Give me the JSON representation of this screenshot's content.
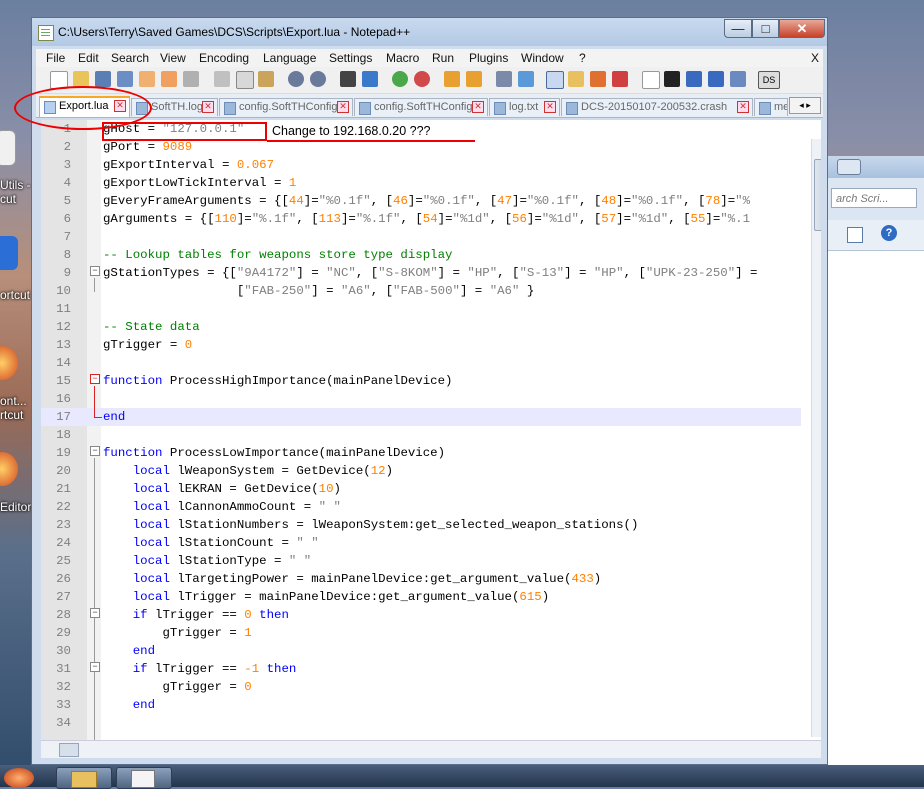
{
  "window": {
    "title": "C:\\Users\\Terry\\Saved Games\\DCS\\Scripts\\Export.lua - Notepad++",
    "min_glyph": "—",
    "max_glyph": "□",
    "close_glyph": "✕"
  },
  "desktop": {
    "icons": [
      {
        "label": "Utils -\ncut"
      },
      {
        "label": "ortcut"
      },
      {
        "label": "ont...\nrtcut"
      },
      {
        "label": "Editor"
      }
    ]
  },
  "bg_window": {
    "search_placeholder": "arch Scri..."
  },
  "menu": [
    "File",
    "Edit",
    "Search",
    "View",
    "Encoding",
    "Language",
    "Settings",
    "Macro",
    "Run",
    "Plugins",
    "Window",
    "?"
  ],
  "menu_close": "X",
  "tabs": [
    {
      "label": "Export.lua",
      "active": true
    },
    {
      "label": "SoftTH.log",
      "active": false
    },
    {
      "label": "config.SoftTHConfig",
      "active": false
    },
    {
      "label": "config.SoftTHConfig",
      "active": false
    },
    {
      "label": "log.txt",
      "active": false
    },
    {
      "label": "DCS-20150107-200532.crash",
      "active": false
    },
    {
      "label": "me.lo",
      "active": false
    }
  ],
  "tab_close": "✕",
  "annotation": "Change to 192.168.0.20 ???",
  "colors": {
    "keyword": "#0000ff",
    "number": "#ff8000",
    "string": "#808080",
    "comment": "#008000",
    "annotation": "#e00000"
  },
  "lines": [
    {
      "n": "1",
      "segs": [
        [
          "",
          "gHost = "
        ],
        [
          "s",
          "\"127.0.0.1\""
        ]
      ]
    },
    {
      "n": "2",
      "segs": [
        [
          "",
          "gPort = "
        ],
        [
          "n",
          "9089"
        ]
      ]
    },
    {
      "n": "3",
      "segs": [
        [
          "",
          "gExportInterval = "
        ],
        [
          "n",
          "0.067"
        ]
      ]
    },
    {
      "n": "4",
      "segs": [
        [
          "",
          "gExportLowTickInterval = "
        ],
        [
          "n",
          "1"
        ]
      ]
    },
    {
      "n": "5",
      "segs": [
        [
          "",
          "gEveryFrameArguments = {["
        ],
        [
          "n",
          "44"
        ],
        [
          "",
          "]="
        ],
        [
          "s",
          "\"%0.1f\""
        ],
        [
          "",
          ", ["
        ],
        [
          "n",
          "46"
        ],
        [
          "",
          "]="
        ],
        [
          "s",
          "\"%0.1f\""
        ],
        [
          "",
          ", ["
        ],
        [
          "n",
          "47"
        ],
        [
          "",
          "]="
        ],
        [
          "s",
          "\"%0.1f\""
        ],
        [
          "",
          ", ["
        ],
        [
          "n",
          "48"
        ],
        [
          "",
          "]="
        ],
        [
          "s",
          "\"%0.1f\""
        ],
        [
          "",
          ", ["
        ],
        [
          "n",
          "78"
        ],
        [
          "",
          "]="
        ],
        [
          "s",
          "\"%"
        ]
      ]
    },
    {
      "n": "6",
      "segs": [
        [
          "",
          "gArguments = {["
        ],
        [
          "n",
          "110"
        ],
        [
          "",
          "]="
        ],
        [
          "s",
          "\"%.1f\""
        ],
        [
          "",
          ", ["
        ],
        [
          "n",
          "113"
        ],
        [
          "",
          "]="
        ],
        [
          "s",
          "\"%.1f\""
        ],
        [
          "",
          ", ["
        ],
        [
          "n",
          "54"
        ],
        [
          "",
          "]="
        ],
        [
          "s",
          "\"%1d\""
        ],
        [
          "",
          ", ["
        ],
        [
          "n",
          "56"
        ],
        [
          "",
          "]="
        ],
        [
          "s",
          "\"%1d\""
        ],
        [
          "",
          ", ["
        ],
        [
          "n",
          "57"
        ],
        [
          "",
          "]="
        ],
        [
          "s",
          "\"%1d\""
        ],
        [
          "",
          ", ["
        ],
        [
          "n",
          "55"
        ],
        [
          "",
          "]="
        ],
        [
          "s",
          "\"%.1"
        ]
      ]
    },
    {
      "n": "7",
      "segs": []
    },
    {
      "n": "8",
      "segs": [
        [
          "c",
          "-- Lookup tables for weapons store type display"
        ]
      ]
    },
    {
      "n": "9",
      "segs": [
        [
          "",
          "gStationTypes = {["
        ],
        [
          "s",
          "\"9A4172\""
        ],
        [
          "",
          "] = "
        ],
        [
          "s",
          "\"NC\""
        ],
        [
          "",
          ", ["
        ],
        [
          "s",
          "\"S-8KOM\""
        ],
        [
          "",
          "] = "
        ],
        [
          "s",
          "\"HP\""
        ],
        [
          "",
          ", ["
        ],
        [
          "s",
          "\"S-13\""
        ],
        [
          "",
          "] = "
        ],
        [
          "s",
          "\"HP\""
        ],
        [
          "",
          ", ["
        ],
        [
          "s",
          "\"UPK-23-250\""
        ],
        [
          "",
          "] ="
        ]
      ]
    },
    {
      "n": "10",
      "segs": [
        [
          "",
          "                  ["
        ],
        [
          "s",
          "\"FAB-250\""
        ],
        [
          "",
          "] = "
        ],
        [
          "s",
          "\"A6\""
        ],
        [
          "",
          ", ["
        ],
        [
          "s",
          "\"FAB-500\""
        ],
        [
          "",
          "] = "
        ],
        [
          "s",
          "\"A6\""
        ],
        [
          "",
          " }"
        ]
      ]
    },
    {
      "n": "11",
      "segs": []
    },
    {
      "n": "12",
      "segs": [
        [
          "c",
          "-- State data"
        ]
      ]
    },
    {
      "n": "13",
      "segs": [
        [
          "",
          "gTrigger = "
        ],
        [
          "n",
          "0"
        ]
      ]
    },
    {
      "n": "14",
      "segs": []
    },
    {
      "n": "15",
      "segs": [
        [
          "k",
          "function"
        ],
        [
          "",
          " ProcessHighImportance(mainPanelDevice)"
        ]
      ]
    },
    {
      "n": "16",
      "segs": []
    },
    {
      "n": "17",
      "segs": [
        [
          "k",
          "end"
        ]
      ]
    },
    {
      "n": "18",
      "segs": []
    },
    {
      "n": "19",
      "segs": [
        [
          "k",
          "function"
        ],
        [
          "",
          " ProcessLowImportance(mainPanelDevice)"
        ]
      ]
    },
    {
      "n": "20",
      "segs": [
        [
          "",
          "    "
        ],
        [
          "k",
          "local"
        ],
        [
          "",
          " lWeaponSystem = GetDevice("
        ],
        [
          "n",
          "12"
        ],
        [
          "",
          ")"
        ]
      ]
    },
    {
      "n": "21",
      "segs": [
        [
          "",
          "    "
        ],
        [
          "k",
          "local"
        ],
        [
          "",
          " lEKRAN = GetDevice("
        ],
        [
          "n",
          "10"
        ],
        [
          "",
          ")"
        ]
      ]
    },
    {
      "n": "22",
      "segs": [
        [
          "",
          "    "
        ],
        [
          "k",
          "local"
        ],
        [
          "",
          " lCannonAmmoCount = "
        ],
        [
          "s",
          "\" \""
        ]
      ]
    },
    {
      "n": "23",
      "segs": [
        [
          "",
          "    "
        ],
        [
          "k",
          "local"
        ],
        [
          "",
          " lStationNumbers = lWeaponSystem:get_selected_weapon_stations()"
        ]
      ]
    },
    {
      "n": "24",
      "segs": [
        [
          "",
          "    "
        ],
        [
          "k",
          "local"
        ],
        [
          "",
          " lStationCount = "
        ],
        [
          "s",
          "\" \""
        ]
      ]
    },
    {
      "n": "25",
      "segs": [
        [
          "",
          "    "
        ],
        [
          "k",
          "local"
        ],
        [
          "",
          " lStationType = "
        ],
        [
          "s",
          "\" \""
        ]
      ]
    },
    {
      "n": "26",
      "segs": [
        [
          "",
          "    "
        ],
        [
          "k",
          "local"
        ],
        [
          "",
          " lTargetingPower = mainPanelDevice:get_argument_value("
        ],
        [
          "n",
          "433"
        ],
        [
          "",
          ")"
        ]
      ]
    },
    {
      "n": "27",
      "segs": [
        [
          "",
          "    "
        ],
        [
          "k",
          "local"
        ],
        [
          "",
          " lTrigger = mainPanelDevice:get_argument_value("
        ],
        [
          "n",
          "615"
        ],
        [
          "",
          ")"
        ]
      ]
    },
    {
      "n": "28",
      "segs": [
        [
          "",
          "    "
        ],
        [
          "k",
          "if"
        ],
        [
          "",
          " lTrigger == "
        ],
        [
          "n",
          "0"
        ],
        [
          "",
          " "
        ],
        [
          "k",
          "then"
        ]
      ]
    },
    {
      "n": "29",
      "segs": [
        [
          "",
          "        gTrigger = "
        ],
        [
          "n",
          "1"
        ]
      ]
    },
    {
      "n": "30",
      "segs": [
        [
          "",
          "    "
        ],
        [
          "k",
          "end"
        ]
      ]
    },
    {
      "n": "31",
      "segs": [
        [
          "",
          "    "
        ],
        [
          "k",
          "if"
        ],
        [
          "",
          " lTrigger == "
        ],
        [
          "n",
          "-1"
        ],
        [
          "",
          " "
        ],
        [
          "k",
          "then"
        ]
      ]
    },
    {
      "n": "32",
      "segs": [
        [
          "",
          "        gTrigger = "
        ],
        [
          "n",
          "0"
        ]
      ]
    },
    {
      "n": "33",
      "segs": [
        [
          "",
          "    "
        ],
        [
          "k",
          "end"
        ]
      ]
    },
    {
      "n": "34",
      "segs": []
    }
  ]
}
